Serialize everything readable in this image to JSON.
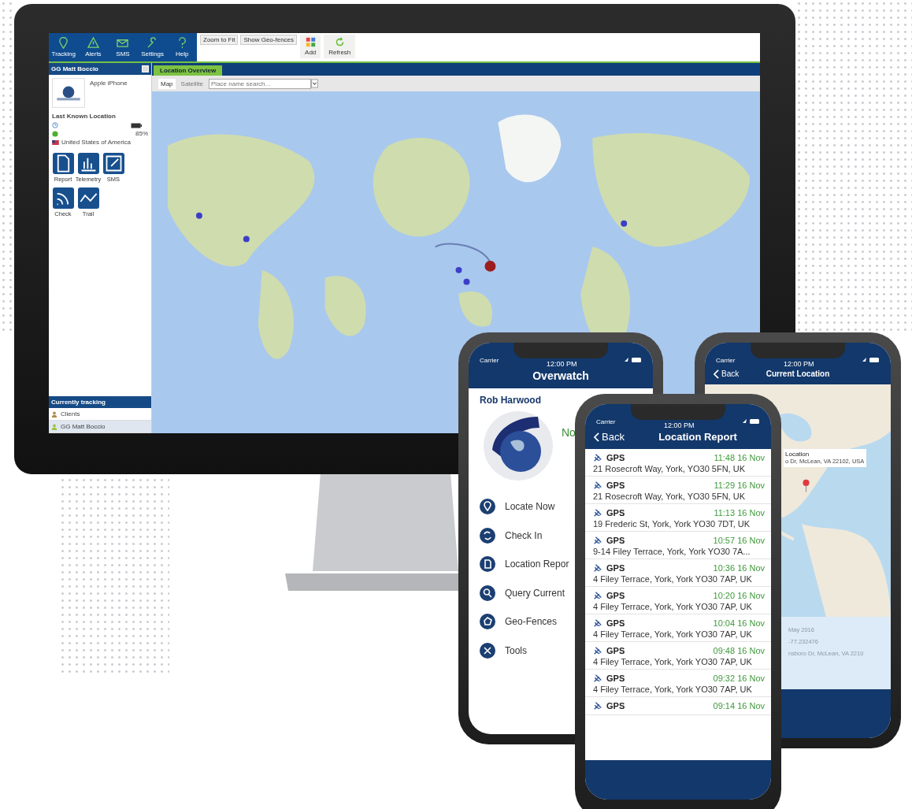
{
  "monitor": {
    "nav": [
      {
        "label": "Tracking",
        "kind": "pin"
      },
      {
        "label": "Alerts",
        "kind": "alert"
      },
      {
        "label": "SMS",
        "kind": "mail"
      },
      {
        "label": "Settings",
        "kind": "wrench"
      },
      {
        "label": "Help",
        "kind": "help"
      }
    ],
    "toolbar_links": [
      {
        "label": "Zoom to Fit"
      },
      {
        "label": "Show Geo-fences"
      }
    ],
    "actions": [
      {
        "label": "Add",
        "kind": "add"
      },
      {
        "label": "Refresh",
        "kind": "refresh"
      }
    ],
    "device_panel": {
      "title": "GG Matt Boccio",
      "device": "Apple iPhone",
      "heading": "Last Known Location",
      "battery": "85%",
      "country": "United States of America",
      "buttons": [
        {
          "label": "Report",
          "kind": "report"
        },
        {
          "label": "Telemetry",
          "kind": "chart"
        },
        {
          "label": "SMS",
          "kind": "edit"
        },
        {
          "label": "Check",
          "kind": "signal"
        },
        {
          "label": "Trail",
          "kind": "trail"
        }
      ]
    },
    "tracking": {
      "title": "Currently tracking",
      "rows": [
        {
          "label": "Clients",
          "selected": false
        },
        {
          "label": "GG Matt Boccio",
          "selected": true
        }
      ]
    },
    "tabs": [
      {
        "label": "Location Overview",
        "selected": true
      }
    ],
    "map_types": [
      {
        "label": "Map",
        "selected": true
      },
      {
        "label": "Satellite",
        "selected": false
      }
    ],
    "search": {
      "placeholder": "Place name search..."
    }
  },
  "phones": {
    "overwatch": {
      "carrier": "Carrier",
      "time": "12:00 PM",
      "title": "Overwatch",
      "user": "Rob Harwood",
      "status_heading": "No",
      "menu": [
        {
          "label": "Locate Now",
          "kind": "pin"
        },
        {
          "label": "Check In",
          "kind": "sync"
        },
        {
          "label": "Location Repor",
          "kind": "doc"
        },
        {
          "label": "Query Current",
          "kind": "search"
        },
        {
          "label": "Geo-Fences",
          "kind": "fence"
        },
        {
          "label": "Tools",
          "kind": "tools"
        }
      ]
    },
    "current_location": {
      "carrier": "Carrier",
      "time": "12:00 PM",
      "back": "Back",
      "title": "Current Location",
      "callout": {
        "title": "Location",
        "address": "o Dr, McLean, VA 22102, USA"
      },
      "details": [
        "May 2016",
        "-77.232476",
        "nsboro Dr, McLean, VA 2210"
      ]
    },
    "location_report": {
      "carrier": "Carrier",
      "time": "12:00 PM",
      "back": "Back",
      "title": "Location Report",
      "entries": [
        {
          "source": "GPS",
          "time": "11:48 16 Nov",
          "address": "21 Rosecroft Way, York, YO30 5FN, UK"
        },
        {
          "source": "GPS",
          "time": "11:29 16 Nov",
          "address": "21 Rosecroft Way, York, YO30 5FN, UK"
        },
        {
          "source": "GPS",
          "time": "11:13 16 Nov",
          "address": "19 Frederic St, York, York YO30 7DT, UK"
        },
        {
          "source": "GPS",
          "time": "10:57 16 Nov",
          "address": "9-14 Filey Terrace, York, York YO30 7A..."
        },
        {
          "source": "GPS",
          "time": "10:36 16 Nov",
          "address": "4 Filey Terrace, York, York YO30 7AP, UK"
        },
        {
          "source": "GPS",
          "time": "10:20 16 Nov",
          "address": "4 Filey Terrace, York, York YO30 7AP, UK"
        },
        {
          "source": "GPS",
          "time": "10:04 16 Nov",
          "address": "4 Filey Terrace, York, York YO30 7AP, UK"
        },
        {
          "source": "GPS",
          "time": "09:48 16 Nov",
          "address": "4 Filey Terrace, York, York YO30 7AP, UK"
        },
        {
          "source": "GPS",
          "time": "09:32 16 Nov",
          "address": "4 Filey Terrace, York, York YO30 7AP, UK"
        },
        {
          "source": "GPS",
          "time": "09:14 16 Nov"
        }
      ]
    }
  }
}
